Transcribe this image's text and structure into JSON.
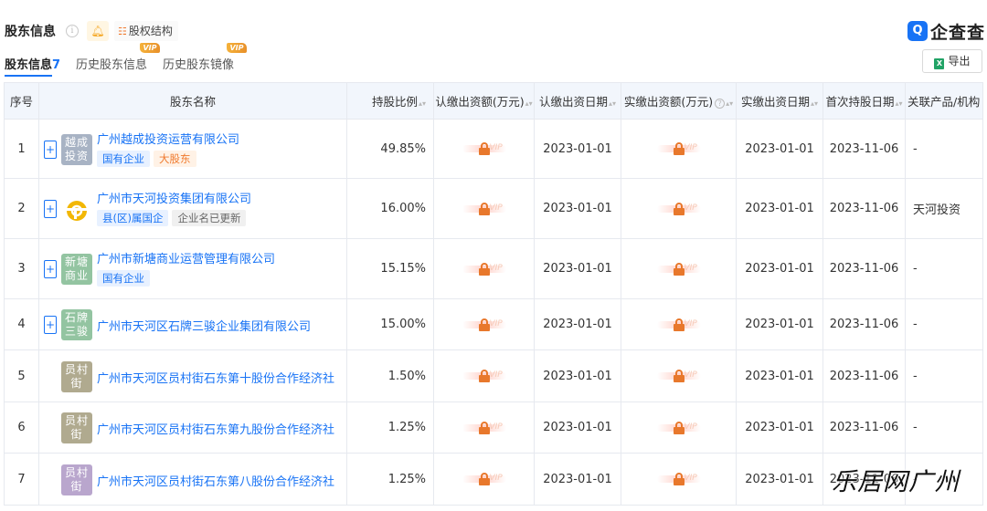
{
  "header": {
    "title": "股东信息",
    "info_icon": "info-icon",
    "bell_icon": "bell-icon",
    "equity_label": "股权结构",
    "logo_mark": "Q",
    "logo_text": "企查查",
    "export_label": "导出",
    "export_icon": "excel-icon"
  },
  "tabs": [
    {
      "label": "股东信息",
      "count": "7",
      "active": true
    },
    {
      "label": "历史股东信息",
      "vip": "VIP"
    },
    {
      "label": "历史股东镜像",
      "vip": "VIP"
    }
  ],
  "table": {
    "columns": [
      "序号",
      "股东名称",
      "持股比例",
      "认缴出资额(万元)",
      "认缴出资日期",
      "实缴出资额(万元)",
      "实缴出资日期",
      "首次持股日期",
      "关联产品/机构"
    ],
    "locked_cell_text": "VIP",
    "rows": [
      {
        "index": "1",
        "avatar": "越成投资",
        "avatar_l1": "越成",
        "avatar_l2": "投资",
        "name": "广州越成投资运营有限公司",
        "tags": [
          "国有企业",
          "大股东"
        ],
        "expandable": true,
        "ratio": "49.85%",
        "sub_date": "2023-01-01",
        "paid_date": "2023-01-01",
        "first_date": "2023-11-06",
        "related": "-"
      },
      {
        "index": "2",
        "avatar": "logo",
        "avatar_l1": "",
        "avatar_l2": "",
        "name": "广州市天河投资集团有限公司",
        "tags": [
          "县(区)属国企",
          "企业名已更新"
        ],
        "expandable": true,
        "ratio": "16.00%",
        "sub_date": "2023-01-01",
        "paid_date": "2023-01-01",
        "first_date": "2023-11-06",
        "related": "天河投资"
      },
      {
        "index": "3",
        "avatar": "新塘商业",
        "avatar_l1": "新塘",
        "avatar_l2": "商业",
        "name": "广州市新塘商业运营管理有限公司",
        "tags": [
          "国有企业"
        ],
        "expandable": true,
        "ratio": "15.15%",
        "sub_date": "2023-01-01",
        "paid_date": "2023-01-01",
        "first_date": "2023-11-06",
        "related": "-"
      },
      {
        "index": "4",
        "avatar": "石牌三骏",
        "avatar_l1": "石牌",
        "avatar_l2": "三骏",
        "name": "广州市天河区石牌三骏企业集团有限公司",
        "tags": [],
        "expandable": true,
        "ratio": "15.00%",
        "sub_date": "2023-01-01",
        "paid_date": "2023-01-01",
        "first_date": "2023-11-06",
        "related": "-"
      },
      {
        "index": "5",
        "avatar": "员村街",
        "avatar_l1": "员村",
        "avatar_l2": "街",
        "name": "广州市天河区员村街石东第十股份合作经济社",
        "tags": [],
        "expandable": false,
        "ratio": "1.50%",
        "sub_date": "2023-01-01",
        "paid_date": "2023-01-01",
        "first_date": "2023-11-06",
        "related": "-"
      },
      {
        "index": "6",
        "avatar": "员村街",
        "avatar_l1": "员村",
        "avatar_l2": "街",
        "name": "广州市天河区员村街石东第九股份合作经济社",
        "tags": [],
        "expandable": false,
        "ratio": "1.25%",
        "sub_date": "2023-01-01",
        "paid_date": "2023-01-01",
        "first_date": "2023-11-06",
        "related": "-"
      },
      {
        "index": "7",
        "avatar": "员村街",
        "avatar_l1": "员村",
        "avatar_l2": "街",
        "name": "广州市天河区员村街石东第八股份合作经济社",
        "tags": [],
        "expandable": false,
        "ratio": "1.25%",
        "sub_date": "2023-01-01",
        "paid_date": "2023-01-01",
        "first_date": "2023-11-06",
        "related": "-"
      }
    ]
  },
  "watermark": "乐居网广州"
}
